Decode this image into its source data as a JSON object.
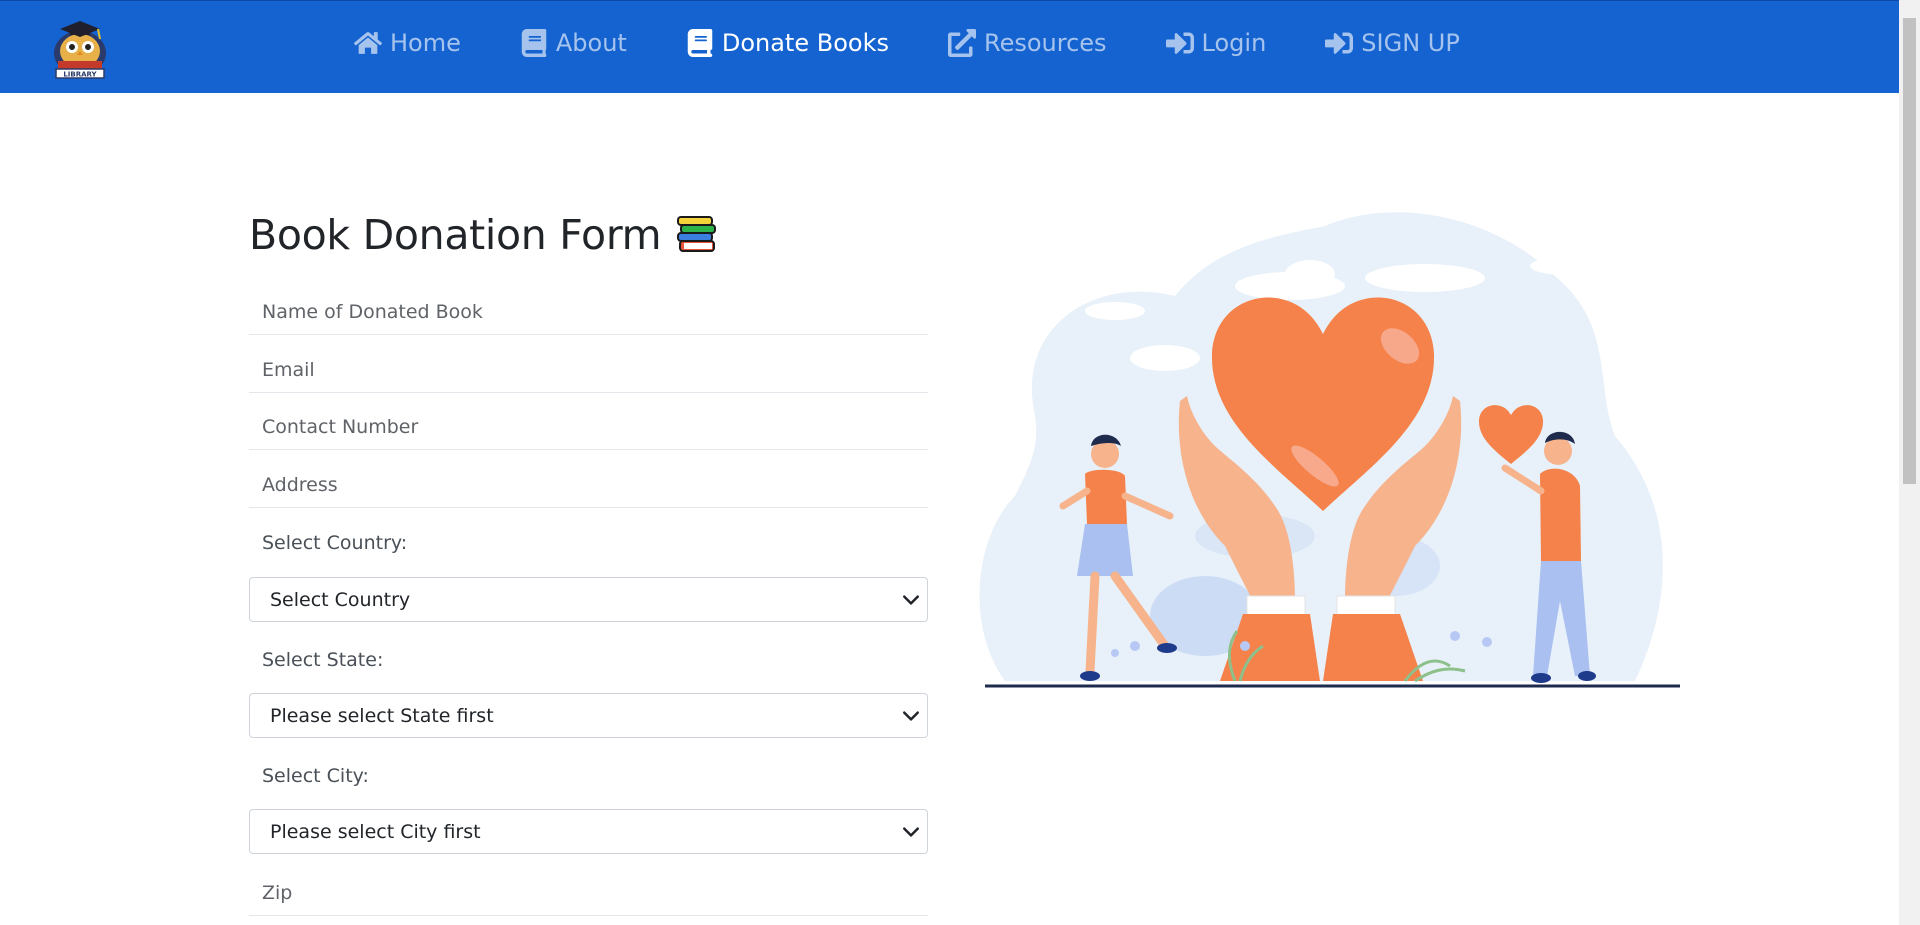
{
  "nav": {
    "logo_icon": "library-logo-icon",
    "items": [
      {
        "label": "Home",
        "icon": "home-icon",
        "active": false
      },
      {
        "label": "About",
        "icon": "book-icon",
        "active": false
      },
      {
        "label": "Donate Books",
        "icon": "book-open-icon",
        "active": true
      },
      {
        "label": "Resources",
        "icon": "external-link-icon",
        "active": false
      },
      {
        "label": "Login",
        "icon": "sign-in-icon",
        "active": false
      },
      {
        "label": "SIGN UP",
        "icon": "sign-in-icon",
        "active": false
      }
    ]
  },
  "form": {
    "title": "Book Donation Form",
    "title_icon": "books-stack-icon",
    "book_name_placeholder": "Name of Donated Book",
    "email_placeholder": "Email",
    "contact_placeholder": "Contact Number",
    "address_placeholder": "Address",
    "country_label": "Select Country:",
    "country_value": "Select Country",
    "state_label": "Select State:",
    "state_value": "Please select State first",
    "city_label": "Select City:",
    "city_value": "Please select City first",
    "zip_placeholder": "Zip"
  },
  "illustration": {
    "icon": "donation-hands-heart-illustration"
  },
  "colors": {
    "navbar": "#1463d0",
    "accent_orange": "#f4824a"
  }
}
